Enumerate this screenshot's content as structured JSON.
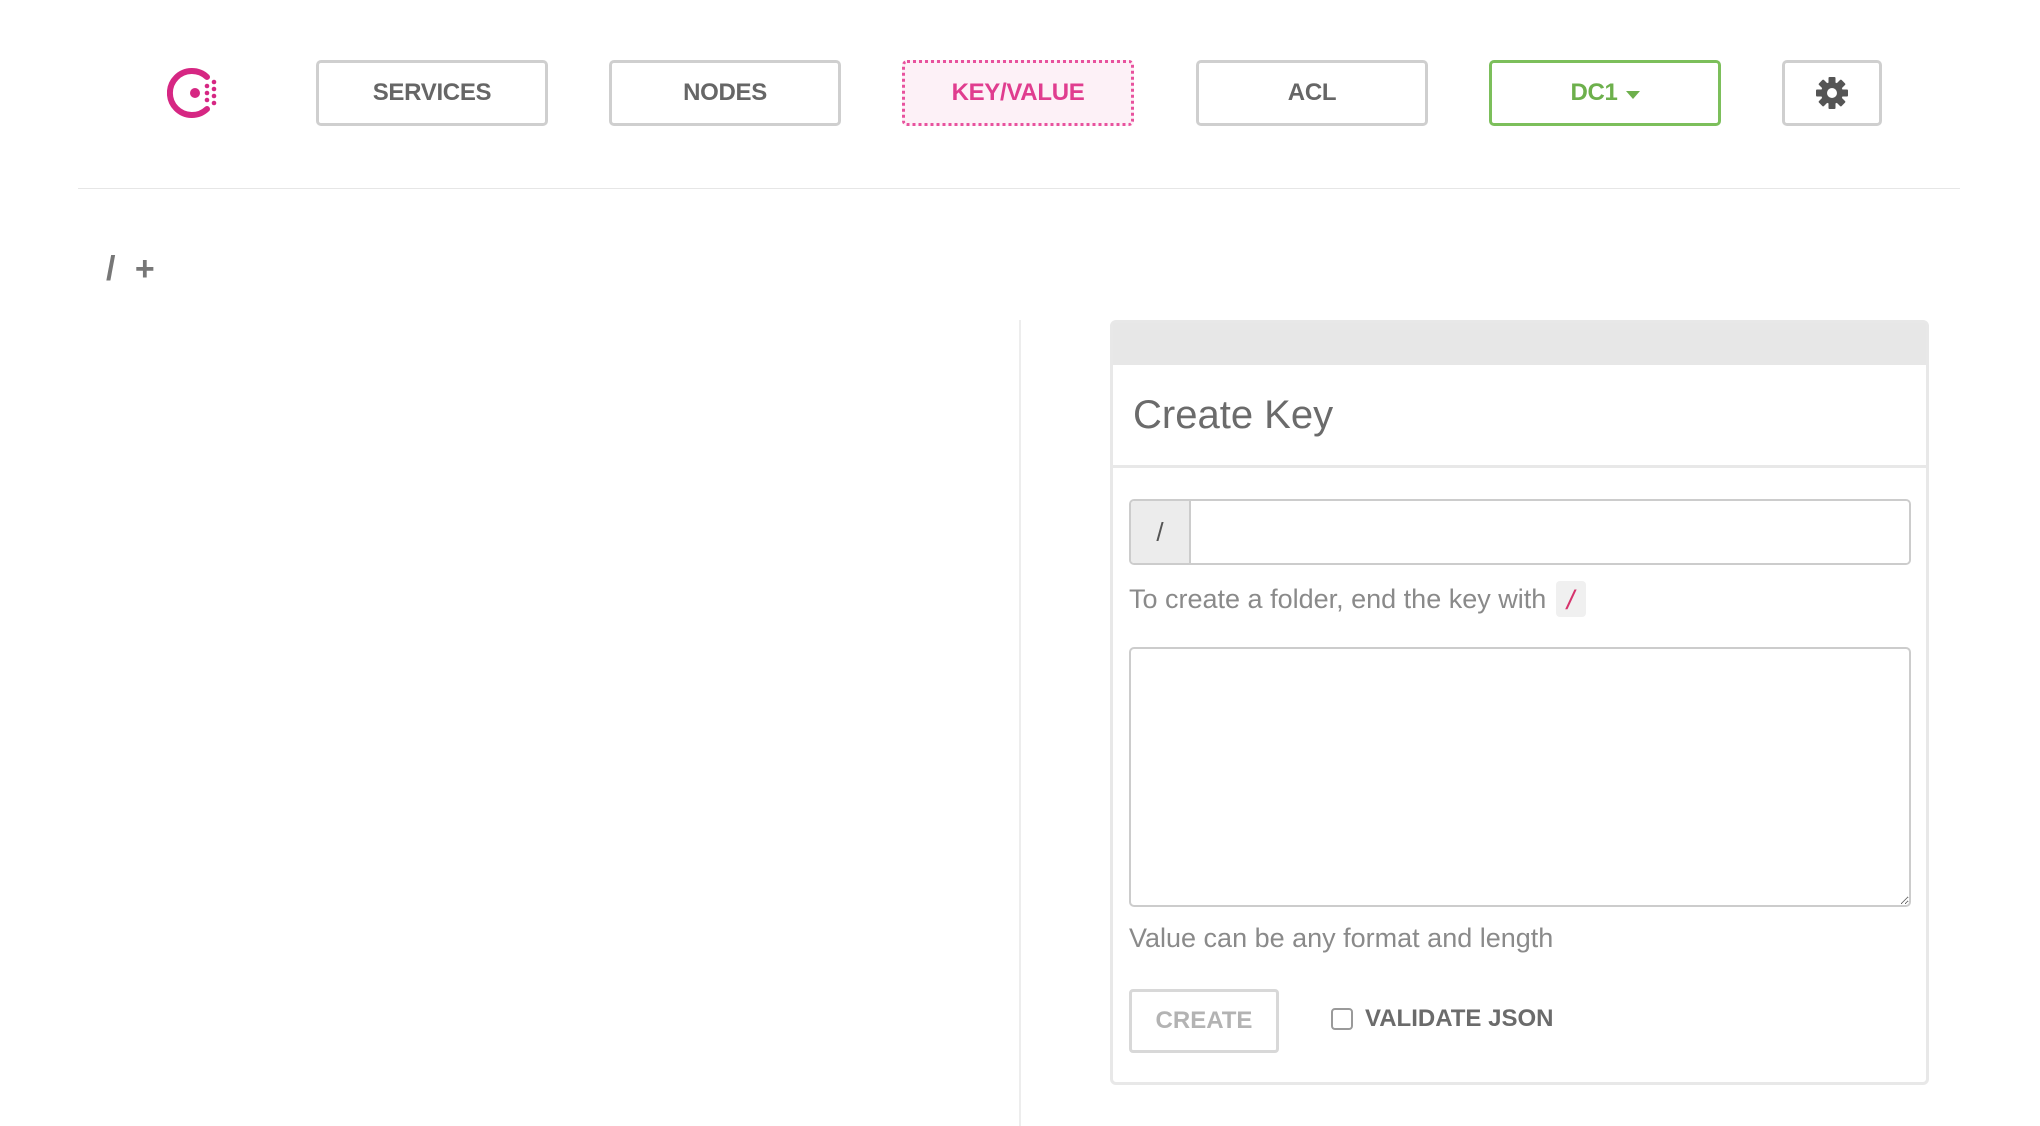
{
  "nav": {
    "services": "SERVICES",
    "nodes": "NODES",
    "key_value": "KEY/VALUE",
    "acl": "ACL",
    "datacenter": "DC1"
  },
  "breadcrumb": {
    "root": "/",
    "add": "+"
  },
  "panel": {
    "title": "Create Key",
    "key_prefix": "/",
    "key_value": "",
    "key_hint": "To create a folder, end the key with",
    "key_hint_code": "/",
    "value": "",
    "value_hint": "Value can be any format and length",
    "create_label": "CREATE",
    "validate_label": "VALIDATE JSON"
  },
  "colors": {
    "accent": "#e03d8f",
    "datacenter": "#6db04c"
  },
  "icons": {
    "logo": "consul-logo-icon",
    "settings": "gear-icon",
    "dropdown": "caret-down-icon"
  }
}
